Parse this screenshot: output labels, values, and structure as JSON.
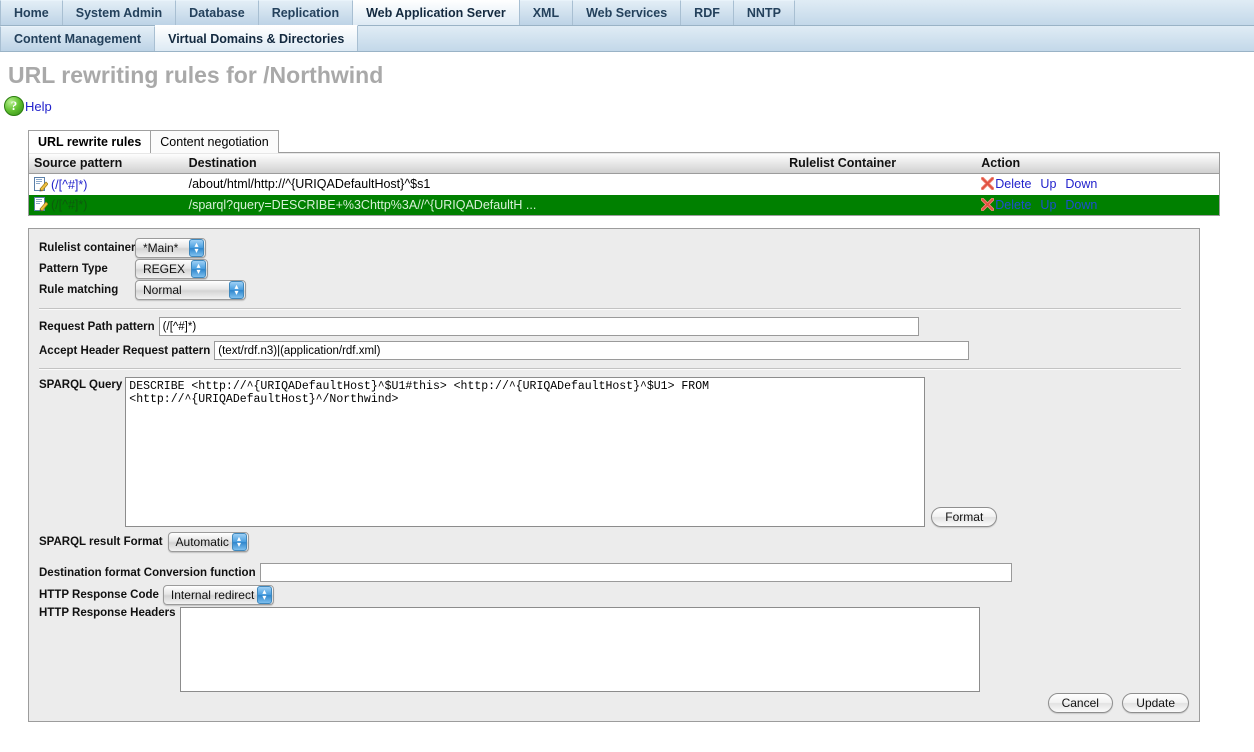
{
  "nav": {
    "row1": [
      {
        "label": "Home",
        "active": false
      },
      {
        "label": "System Admin",
        "active": false
      },
      {
        "label": "Database",
        "active": false
      },
      {
        "label": "Replication",
        "active": false
      },
      {
        "label": "Web Application Server",
        "active": true
      },
      {
        "label": "XML",
        "active": false
      },
      {
        "label": "Web Services",
        "active": false
      },
      {
        "label": "RDF",
        "active": false
      },
      {
        "label": "NNTP",
        "active": false
      }
    ],
    "row2": [
      {
        "label": "Content Management",
        "active": false
      },
      {
        "label": "Virtual Domains & Directories",
        "active": true
      }
    ]
  },
  "page": {
    "title": "URL rewriting rules for /Northwind",
    "help_label": "Help",
    "help_icon": "question-mark-circle-icon"
  },
  "tabs": [
    {
      "label": "URL rewrite rules",
      "active": true
    },
    {
      "label": "Content negotiation",
      "active": false
    }
  ],
  "table": {
    "headers": [
      "Source pattern",
      "Destination",
      "Rulelist Container",
      "Action"
    ],
    "actions": {
      "delete": "Delete",
      "up": "Up",
      "down": "Down"
    },
    "rows": [
      {
        "source": "(/[^#]*)",
        "destination": "/about/html/http://^{URIQADefaultHost}^$s1",
        "container": "",
        "selected": false
      },
      {
        "source": "(/[^#]*)",
        "destination": "/sparql?query=DESCRIBE+%3Chttp%3A//^{URIQADefaultH ...",
        "container": "",
        "selected": true
      }
    ]
  },
  "form": {
    "rulelist_container": {
      "label": "Rulelist container",
      "value": "*Main*"
    },
    "pattern_type": {
      "label": "Pattern Type",
      "value": "REGEX"
    },
    "rule_matching": {
      "label": "Rule matching",
      "value": "Normal"
    },
    "request_path_pattern": {
      "label": "Request Path pattern",
      "value": "(/[^#]*)"
    },
    "accept_header_pattern": {
      "label": "Accept Header Request pattern",
      "value": "(text/rdf.n3)|(application/rdf.xml)"
    },
    "sparql_query": {
      "label": "SPARQL Query",
      "value": "DESCRIBE <http://^{URIQADefaultHost}^$U1#this> <http://^{URIQADefaultHost}^$U1> FROM\n<http://^{URIQADefaultHost}^/Northwind>"
    },
    "format_button": "Format",
    "sparql_result_format": {
      "label": "SPARQL result Format",
      "value": "Automatic"
    },
    "destination_conversion": {
      "label": "Destination format Conversion function",
      "value": ""
    },
    "http_response_code": {
      "label": "HTTP Response Code",
      "value": "Internal redirect"
    },
    "http_response_headers": {
      "label": "HTTP Response Headers",
      "value": ""
    },
    "cancel_button": "Cancel",
    "update_button": "Update"
  },
  "colors": {
    "selected_row": "#008000",
    "link": "#2222cc",
    "title_gray": "#a9a9a9",
    "nav_blue": "#c4d8e8"
  }
}
